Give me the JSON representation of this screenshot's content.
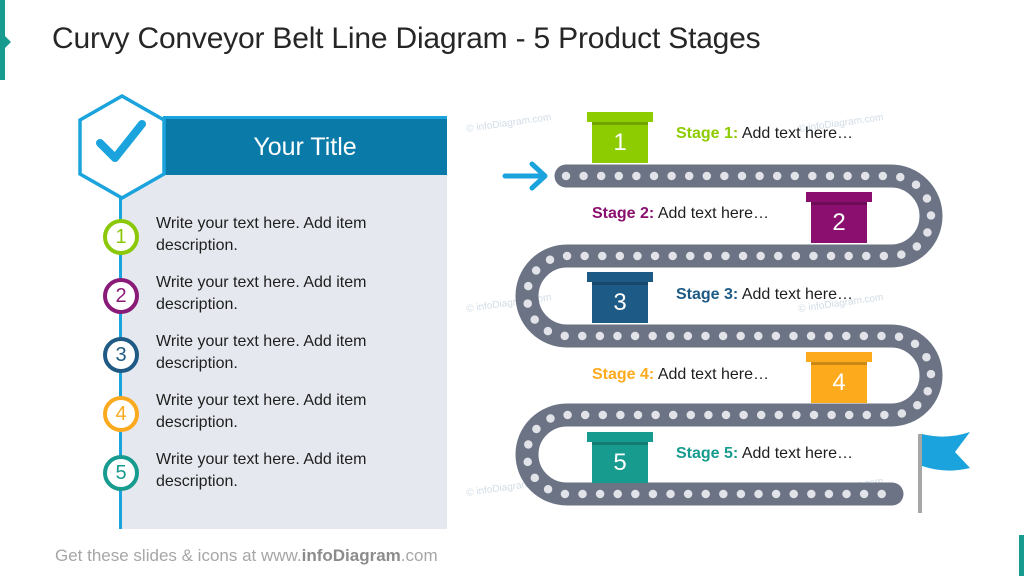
{
  "slide": {
    "title": "Curvy Conveyor Belt Line Diagram - 5 Product Stages",
    "accent_color": "#179b8f"
  },
  "panel": {
    "title": "Your Title",
    "title_bar_color": "#0a7aa8",
    "line_color": "#1aa3dc",
    "icon": "checkmark-icon",
    "items": [
      {
        "number": "1",
        "text": "Write your text here. Add item description.",
        "color": "#8cc80a"
      },
      {
        "number": "2",
        "text": "Write your text here. Add item description.",
        "color": "#8a1a78"
      },
      {
        "number": "3",
        "text": "Write your text here. Add item description.",
        "color": "#1f5a85"
      },
      {
        "number": "4",
        "text": "Write your text here. Add item description.",
        "color": "#fbaa1f"
      },
      {
        "number": "5",
        "text": "Write your text here. Add item description.",
        "color": "#179b8f"
      }
    ]
  },
  "diagram": {
    "belt_color": "#6b7385",
    "belt_dot_color": "#e1e3e8",
    "start_icon": "arrow-right-icon",
    "start_icon_color": "#1aa3dc",
    "end_icon": "flag-icon",
    "end_icon_color": "#1aa3dc",
    "stages": [
      {
        "number": "1",
        "label": "Stage 1:",
        "text": "Add text here…",
        "color": "#8ccc00"
      },
      {
        "number": "2",
        "label": "Stage 2:",
        "text": "Add text here…",
        "color": "#8a0f6e"
      },
      {
        "number": "3",
        "label": "Stage 3:",
        "text": "Add text here…",
        "color": "#1d5a86"
      },
      {
        "number": "4",
        "label": "Stage 4:",
        "text": "Add text here…",
        "color": "#fdaa1d"
      },
      {
        "number": "5",
        "label": "Stage 5:",
        "text": "Add text here…",
        "color": "#179b8f"
      }
    ]
  },
  "watermark": "© infoDiagram.com",
  "footer": {
    "prefix": "Get these slides & icons at www.",
    "brand": "infoDiagram",
    "suffix": ".com"
  }
}
